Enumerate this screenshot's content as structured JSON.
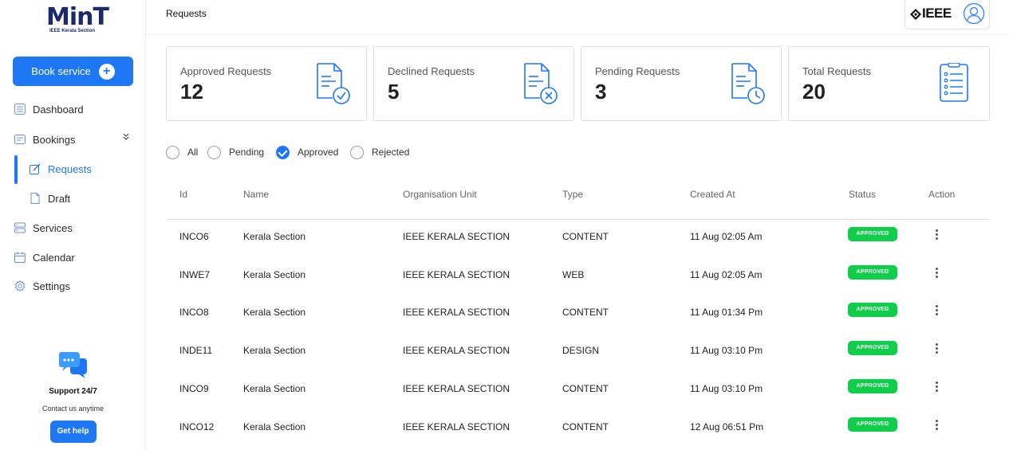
{
  "brand": {
    "logo_text": "MinT",
    "logo_sub": "IEEE Kerala Section"
  },
  "sidebar": {
    "book_label": "Book service",
    "items": [
      {
        "label": "Dashboard"
      },
      {
        "label": "Bookings"
      },
      {
        "label": "Requests"
      },
      {
        "label": "Draft"
      },
      {
        "label": "Services"
      },
      {
        "label": "Calendar"
      },
      {
        "label": "Settings"
      }
    ],
    "support": {
      "title": "Support 24/7",
      "subtitle": "Contact us anytime",
      "button": "Get help"
    }
  },
  "header": {
    "title": "Requests",
    "org_logo_text": "IEEE"
  },
  "stats": [
    {
      "label": "Approved Requests",
      "value": "12",
      "icon": "doc-check-icon"
    },
    {
      "label": "Declined Requests",
      "value": "5",
      "icon": "doc-x-icon"
    },
    {
      "label": "Pending Requests",
      "value": "3",
      "icon": "doc-clock-icon"
    },
    {
      "label": "Total Requests",
      "value": "20",
      "icon": "list-icon"
    }
  ],
  "filters": {
    "options": [
      "All",
      "Pending",
      "Approved",
      "Rejected"
    ],
    "selected": "Approved"
  },
  "table": {
    "columns": [
      "Id",
      "Name",
      "Organisation Unit",
      "Type",
      "Created At",
      "Status",
      "Action"
    ],
    "rows": [
      {
        "id": "INCO6",
        "name": "Kerala Section",
        "org": "IEEE KERALA SECTION",
        "type": "CONTENT",
        "created": "11 Aug 02:05 Am",
        "status": "APPROVED"
      },
      {
        "id": "INWE7",
        "name": "Kerala Section",
        "org": "IEEE KERALA SECTION",
        "type": "WEB",
        "created": "11 Aug 02:05 Am",
        "status": "APPROVED"
      },
      {
        "id": "INCO8",
        "name": "Kerala Section",
        "org": "IEEE KERALA SECTION",
        "type": "CONTENT",
        "created": "11 Aug 01:34 Pm",
        "status": "APPROVED"
      },
      {
        "id": "INDE11",
        "name": "Kerala Section",
        "org": "IEEE KERALA SECTION",
        "type": "DESIGN",
        "created": "11 Aug 03:10 Pm",
        "status": "APPROVED"
      },
      {
        "id": "INCO9",
        "name": "Kerala Section",
        "org": "IEEE KERALA SECTION",
        "type": "CONTENT",
        "created": "11 Aug 03:10 Pm",
        "status": "APPROVED"
      },
      {
        "id": "INCO12",
        "name": "Kerala Section",
        "org": "IEEE KERALA SECTION",
        "type": "CONTENT",
        "created": "12 Aug 06:51 Pm",
        "status": "APPROVED"
      }
    ]
  },
  "colors": {
    "accent": "#1e78f5",
    "approved": "#0fcf4a",
    "border": "#dedede"
  }
}
